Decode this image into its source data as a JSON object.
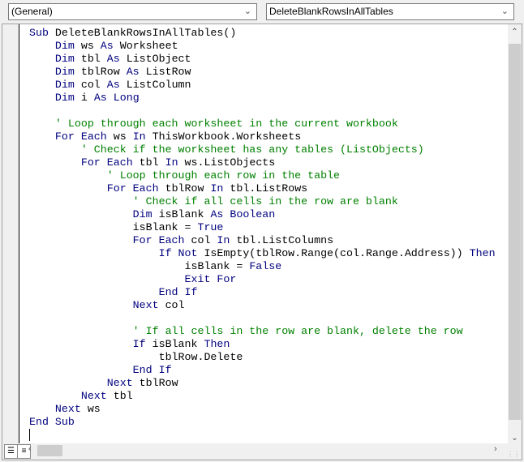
{
  "object_combo": {
    "value": "(General)"
  },
  "procedure_combo": {
    "value": "DeleteBlankRowsInAllTables"
  },
  "colors": {
    "keyword": "#00007f",
    "comment": "#008000",
    "text": "#000000"
  },
  "code_lines": [
    [
      [
        "kw",
        "Sub "
      ],
      [
        "tx",
        "DeleteBlankRowsInAllTables()"
      ]
    ],
    [
      [
        "tx",
        "    "
      ],
      [
        "kw",
        "Dim "
      ],
      [
        "tx",
        "ws "
      ],
      [
        "kw",
        "As "
      ],
      [
        "tx",
        "Worksheet"
      ]
    ],
    [
      [
        "tx",
        "    "
      ],
      [
        "kw",
        "Dim "
      ],
      [
        "tx",
        "tbl "
      ],
      [
        "kw",
        "As "
      ],
      [
        "tx",
        "ListObject"
      ]
    ],
    [
      [
        "tx",
        "    "
      ],
      [
        "kw",
        "Dim "
      ],
      [
        "tx",
        "tblRow "
      ],
      [
        "kw",
        "As "
      ],
      [
        "tx",
        "ListRow"
      ]
    ],
    [
      [
        "tx",
        "    "
      ],
      [
        "kw",
        "Dim "
      ],
      [
        "tx",
        "col "
      ],
      [
        "kw",
        "As "
      ],
      [
        "tx",
        "ListColumn"
      ]
    ],
    [
      [
        "tx",
        "    "
      ],
      [
        "kw",
        "Dim "
      ],
      [
        "tx",
        "i "
      ],
      [
        "kw",
        "As Long"
      ]
    ],
    [],
    [
      [
        "tx",
        "    "
      ],
      [
        "cm",
        "' Loop through each worksheet in the current workbook"
      ]
    ],
    [
      [
        "tx",
        "    "
      ],
      [
        "kw",
        "For Each "
      ],
      [
        "tx",
        "ws "
      ],
      [
        "kw",
        "In "
      ],
      [
        "tx",
        "ThisWorkbook.Worksheets"
      ]
    ],
    [
      [
        "tx",
        "        "
      ],
      [
        "cm",
        "' Check if the worksheet has any tables (ListObjects)"
      ]
    ],
    [
      [
        "tx",
        "        "
      ],
      [
        "kw",
        "For Each "
      ],
      [
        "tx",
        "tbl "
      ],
      [
        "kw",
        "In "
      ],
      [
        "tx",
        "ws.ListObjects"
      ]
    ],
    [
      [
        "tx",
        "            "
      ],
      [
        "cm",
        "' Loop through each row in the table"
      ]
    ],
    [
      [
        "tx",
        "            "
      ],
      [
        "kw",
        "For Each "
      ],
      [
        "tx",
        "tblRow "
      ],
      [
        "kw",
        "In "
      ],
      [
        "tx",
        "tbl.ListRows"
      ]
    ],
    [
      [
        "tx",
        "                "
      ],
      [
        "cm",
        "' Check if all cells in the row are blank"
      ]
    ],
    [
      [
        "tx",
        "                "
      ],
      [
        "kw",
        "Dim "
      ],
      [
        "tx",
        "isBlank "
      ],
      [
        "kw",
        "As Boolean"
      ]
    ],
    [
      [
        "tx",
        "                isBlank = "
      ],
      [
        "kw",
        "True"
      ]
    ],
    [
      [
        "tx",
        "                "
      ],
      [
        "kw",
        "For Each "
      ],
      [
        "tx",
        "col "
      ],
      [
        "kw",
        "In "
      ],
      [
        "tx",
        "tbl.ListColumns"
      ]
    ],
    [
      [
        "tx",
        "                    "
      ],
      [
        "kw",
        "If Not "
      ],
      [
        "tx",
        "IsEmpty(tblRow.Range(col.Range.Address)) "
      ],
      [
        "kw",
        "Then"
      ]
    ],
    [
      [
        "tx",
        "                        isBlank = "
      ],
      [
        "kw",
        "False"
      ]
    ],
    [
      [
        "tx",
        "                        "
      ],
      [
        "kw",
        "Exit For"
      ]
    ],
    [
      [
        "tx",
        "                    "
      ],
      [
        "kw",
        "End If"
      ]
    ],
    [
      [
        "tx",
        "                "
      ],
      [
        "kw",
        "Next "
      ],
      [
        "tx",
        "col"
      ]
    ],
    [],
    [
      [
        "tx",
        "                "
      ],
      [
        "cm",
        "' If all cells in the row are blank, delete the row"
      ]
    ],
    [
      [
        "tx",
        "                "
      ],
      [
        "kw",
        "If "
      ],
      [
        "tx",
        "isBlank "
      ],
      [
        "kw",
        "Then"
      ]
    ],
    [
      [
        "tx",
        "                    tblRow.Delete"
      ]
    ],
    [
      [
        "tx",
        "                "
      ],
      [
        "kw",
        "End If"
      ]
    ],
    [
      [
        "tx",
        "            "
      ],
      [
        "kw",
        "Next "
      ],
      [
        "tx",
        "tblRow"
      ]
    ],
    [
      [
        "tx",
        "        "
      ],
      [
        "kw",
        "Next "
      ],
      [
        "tx",
        "tbl"
      ]
    ],
    [
      [
        "tx",
        "    "
      ],
      [
        "kw",
        "Next "
      ],
      [
        "tx",
        "ws"
      ]
    ],
    [
      [
        "kw",
        "End Sub"
      ]
    ]
  ]
}
